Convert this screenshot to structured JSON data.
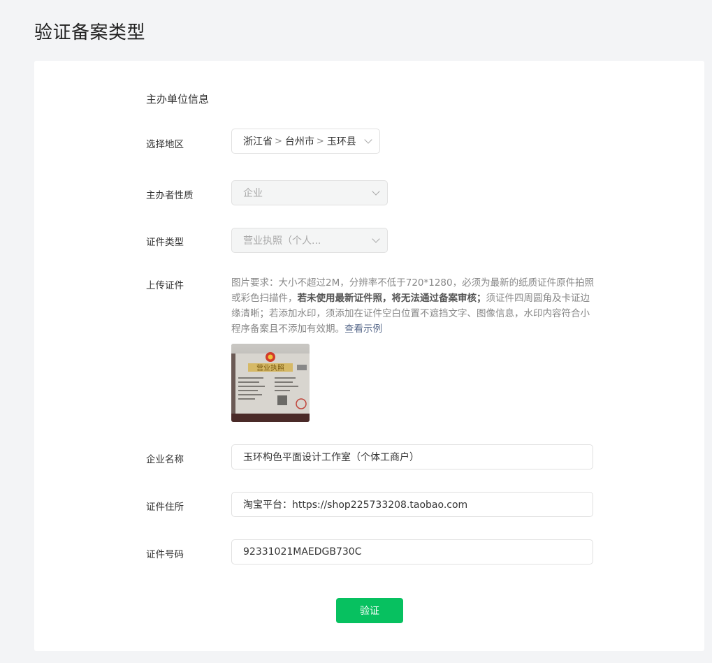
{
  "page": {
    "title": "验证备案类型"
  },
  "form": {
    "section_title": "主办单位信息",
    "region": {
      "label": "选择地区",
      "province": "浙江省",
      "city": "台州市",
      "county": "玉环县"
    },
    "organizer_type": {
      "label": "主办者性质",
      "value": "企业"
    },
    "cert_type": {
      "label": "证件类型",
      "value": "营业执照（个人..."
    },
    "upload": {
      "label": "上传证件",
      "desc_part1": "图片要求：大小不超过2M，分辨率不低于720*1280，必须为最新的纸质证件原件拍照或彩色扫描件，",
      "desc_bold": "若未使用最新证件照，将无法通过备案审核；",
      "desc_part2": "须证件四周圆角及卡证边缘清晰；若添加水印，须添加在证件空白位置不遮挡文字、图像信息，水印内容符合小程序备案且不添加有效期。",
      "example_link": "查看示例",
      "thumb_title": "营业执照"
    },
    "company_name": {
      "label": "企业名称",
      "value": "玉环构色平面设计工作室（个体工商户）"
    },
    "cert_address": {
      "label": "证件住所",
      "value": "淘宝平台：https://shop225733208.taobao.com"
    },
    "cert_number": {
      "label": "证件号码",
      "value": "92331021MAEDGB730C"
    },
    "submit_label": "验证"
  },
  "colors": {
    "primary": "#07c160",
    "link": "#5a6b8c",
    "background": "#f3f4f6"
  }
}
